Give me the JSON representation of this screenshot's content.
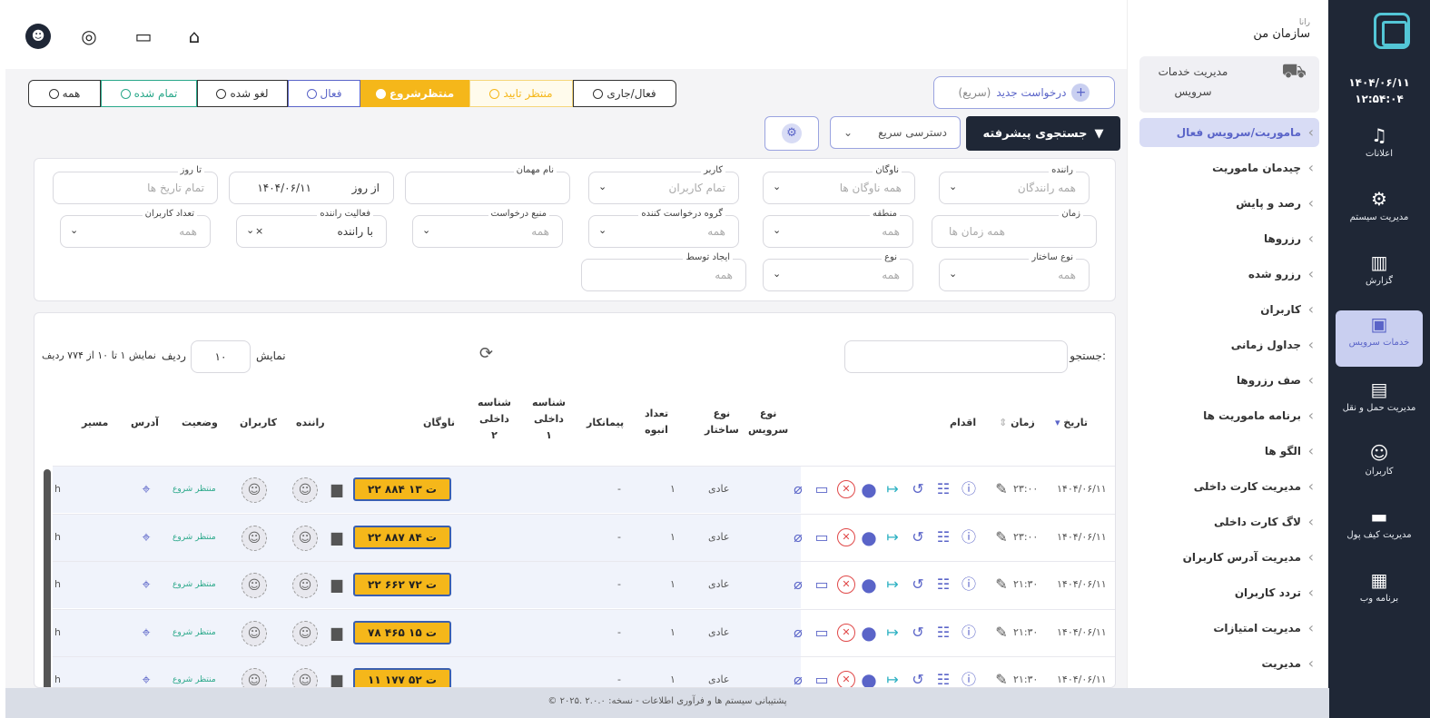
{
  "dark_nav": {
    "date": "۱۴۰۴/۰۶/۱۱",
    "time": "۱۲:۵۴:۰۴",
    "items": [
      {
        "label": "اعلانات",
        "icon": "bell-icon"
      },
      {
        "label": "مدیریت سیستم",
        "icon": "gear-icon"
      },
      {
        "label": "گزارش",
        "icon": "chart-icon"
      },
      {
        "label": "خدمات سرویس",
        "icon": "bus-icon"
      },
      {
        "label": "مدیریت حمل و نقل",
        "icon": "car-icon"
      },
      {
        "label": "کاربران",
        "icon": "users-icon"
      },
      {
        "label": "مدیریت کیف پول",
        "icon": "wallet-icon"
      },
      {
        "label": "برنامه وب",
        "icon": "apps-icon"
      }
    ]
  },
  "org": {
    "small": "رانا",
    "name": "سازمان من"
  },
  "menu": {
    "section_title_1": "مدیریت خدمات",
    "section_title_2": "سرویس",
    "items": [
      "ماموریت/سرویس فعال",
      "چیدمان ماموریت",
      "رصد و پایش",
      "رزروها",
      "رزرو شده",
      "کاربران",
      "جداول زمانی",
      "صف رزروها",
      "برنامه ماموریت ها",
      "الگو ها",
      "مدیریت کارت داخلی",
      "لاگ کارت داخلی",
      "مدیریت آدرس کاربران",
      "تردد کاربران",
      "مدیریت امتیازات",
      "مدیریت"
    ]
  },
  "tabs": [
    "همه",
    "تمام شده",
    "لغو شده",
    "فعال",
    "منتظرشروع",
    "منتظر تایید",
    "فعال/جاری"
  ],
  "new_request": {
    "label": "درخواست جدید",
    "sub": "(سریع)"
  },
  "advanced_search": "جستجوی پیشرفته",
  "quick_access": "دسترسی سریع",
  "filters": {
    "to_day": {
      "label": "تا روز",
      "value": "تمام تاریخ ها"
    },
    "from_day": {
      "label": "از روز",
      "value": "۱۴۰۴/۰۶/۱۱"
    },
    "guest": {
      "label": "نام مهمان",
      "value": ""
    },
    "user": {
      "label": "کاربر",
      "value": "تمام کاربران"
    },
    "fleet": {
      "label": "ناوگان",
      "value": "همه ناوگان ها"
    },
    "driver": {
      "label": "راننده",
      "value": "همه رانندگان"
    },
    "user_count": {
      "label": "تعداد کاربران",
      "value": "همه"
    },
    "driver_activity": {
      "label": "فعالیت راننده",
      "value": "با راننده"
    },
    "source": {
      "label": "منبع درخواست",
      "value": "همه"
    },
    "requester_group": {
      "label": "گروه درخواست کننده",
      "value": "همه"
    },
    "region": {
      "label": "منطقه",
      "value": "همه"
    },
    "time": {
      "label": "زمان",
      "value": "همه زمان ها"
    },
    "created_by": {
      "label": "ایجاد توسط",
      "value": "همه"
    },
    "type": {
      "label": "نوع",
      "value": "همه"
    },
    "structure_type": {
      "label": "نوع ساختار",
      "value": "همه"
    }
  },
  "table": {
    "search_label": "جستجو:",
    "show_label": "نمایش",
    "page_size": "۱۰",
    "row_label": "ردیف",
    "info": "نمایش ۱ تا ۱۰ از ۷۷۴ ردیف",
    "headers": {
      "date": "تاریخ",
      "time": "زمان",
      "action": "اقدام",
      "service_type_1": "نوع",
      "service_type_2": "سرویس",
      "structure_1": "نوع",
      "structure_2": "ساختار",
      "bulk_1": "تعداد",
      "bulk_2": "انبوه",
      "contractor": "پیمانکار",
      "internal_id1_1": "شناسه",
      "internal_id1_2": "داخلی",
      "internal_id1_3": "۱",
      "internal_id2_1": "شناسه",
      "internal_id2_2": "داخلی",
      "internal_id2_3": "۲",
      "fleet": "ناوگان",
      "driver": "راننده",
      "users": "کاربران",
      "status": "وضعیت",
      "address": "آدرس",
      "route": "مسیر"
    },
    "rows": [
      {
        "date": "۱۴۰۴/۰۶/۱۱",
        "time": "۲۳:۰۰",
        "service": "عادی",
        "bulk": "۱",
        "contractor": "-",
        "plate": "۲۲ ۸۸۴ ت ۱۳",
        "status": "منتظر شروع",
        "route": "h"
      },
      {
        "date": "۱۴۰۴/۰۶/۱۱",
        "time": "۲۳:۰۰",
        "service": "عادی",
        "bulk": "۱",
        "contractor": "-",
        "plate": "۲۲ ۸۸۷ ت ۸۴",
        "status": "منتظر شروع",
        "route": "h"
      },
      {
        "date": "۱۴۰۴/۰۶/۱۱",
        "time": "۲۱:۳۰",
        "service": "عادی",
        "bulk": "۱",
        "contractor": "-",
        "plate": "۲۲ ۶۶۲ ت ۷۲",
        "status": "منتظر شروع",
        "route": "h"
      },
      {
        "date": "۱۴۰۴/۰۶/۱۱",
        "time": "۲۱:۳۰",
        "service": "عادی",
        "bulk": "۱",
        "contractor": "-",
        "plate": "۷۸ ۴۶۵ ت ۱۵",
        "status": "منتظر شروع",
        "route": "h"
      },
      {
        "date": "۱۴۰۴/۰۶/۱۱",
        "time": "۲۱:۳۰",
        "service": "عادی",
        "bulk": "۱",
        "contractor": "-",
        "plate": "۱۱ ۱۷۷ ت ۵۲",
        "status": "منتظر شروع",
        "route": "h"
      }
    ]
  },
  "footer": "© ۲۰۲۵. پشتیبانی سیستم ها و فرآوری اطلاعات - نسخه: ۲.۰.۰",
  "colors": {
    "dark": "#1f2736",
    "accent": "#5a64c8",
    "yellow": "#f5b71a",
    "green": "#2aa88a"
  }
}
